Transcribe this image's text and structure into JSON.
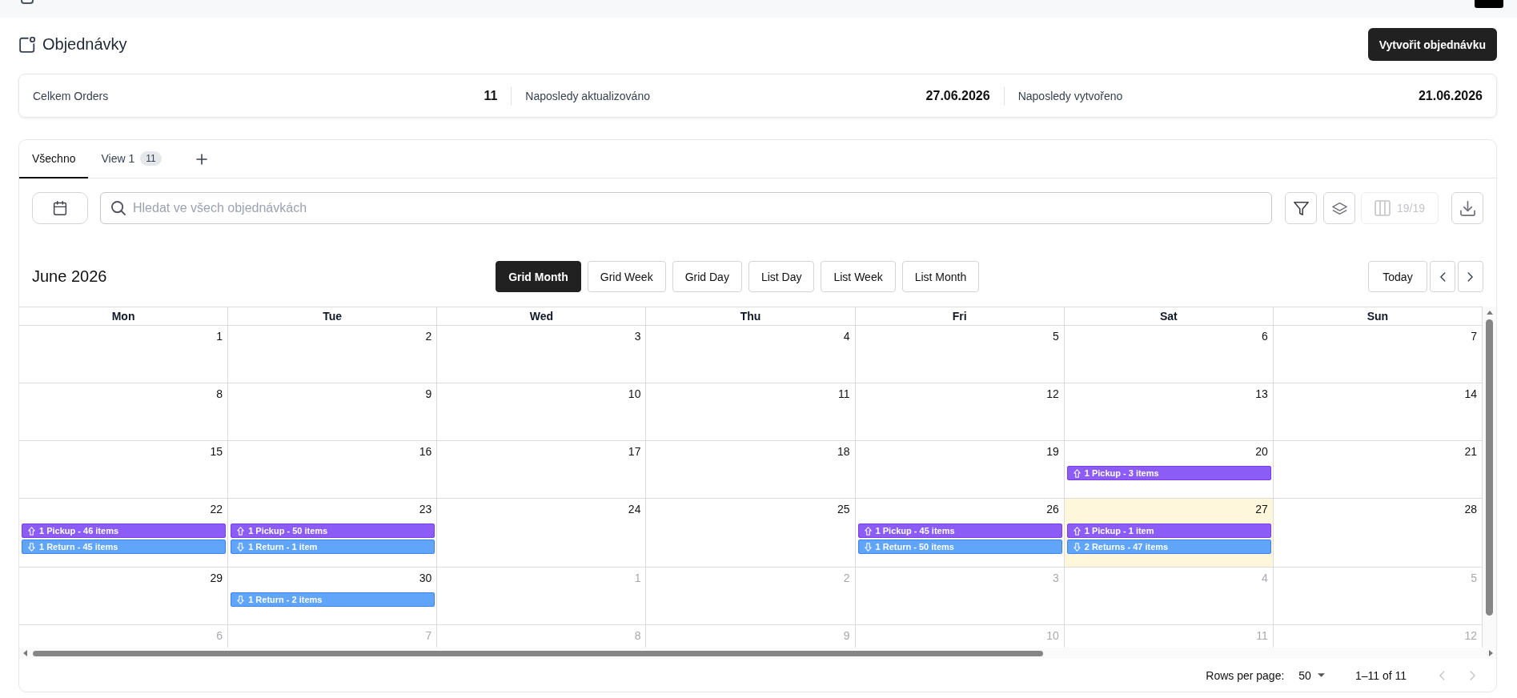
{
  "page": {
    "title": "Objednávky",
    "create_button": "Vytvořit objednávku"
  },
  "stats": [
    {
      "label": "Celkem Orders",
      "value": "11"
    },
    {
      "label": "Naposledy aktualizováno",
      "value": "27.06.2026"
    },
    {
      "label": "Naposledy vytvořeno",
      "value": "21.06.2026"
    }
  ],
  "tabs": [
    {
      "label": "Všechno",
      "selected": true
    },
    {
      "label": "View 1",
      "count": "11",
      "selected": false
    }
  ],
  "toolbar": {
    "search": {
      "placeholder": "Hledat ve všech objednávkách"
    },
    "columns_button": {
      "label": "19/19",
      "disabled": true
    }
  },
  "calendar": {
    "title": "June 2026",
    "views": [
      {
        "label": "Grid Month",
        "selected": true
      },
      {
        "label": "Grid Week",
        "selected": false
      },
      {
        "label": "Grid Day",
        "selected": false
      },
      {
        "label": "List Day",
        "selected": false
      },
      {
        "label": "List Week",
        "selected": false
      },
      {
        "label": "List Month",
        "selected": false
      }
    ],
    "today_button": "Today",
    "weekdays": [
      "Mon",
      "Tue",
      "Wed",
      "Thu",
      "Fri",
      "Sat",
      "Sun"
    ],
    "weeks": [
      {
        "days": [
          {
            "day": "1",
            "outside": false,
            "today": false
          },
          {
            "day": "2",
            "outside": false,
            "today": false
          },
          {
            "day": "3",
            "outside": false,
            "today": false
          },
          {
            "day": "4",
            "outside": false,
            "today": false
          },
          {
            "day": "5",
            "outside": false,
            "today": false
          },
          {
            "day": "6",
            "outside": false,
            "today": false
          },
          {
            "day": "7",
            "outside": false,
            "today": false
          }
        ]
      },
      {
        "days": [
          {
            "day": "8",
            "outside": false,
            "today": false
          },
          {
            "day": "9",
            "outside": false,
            "today": false
          },
          {
            "day": "10",
            "outside": false,
            "today": false
          },
          {
            "day": "11",
            "outside": false,
            "today": false
          },
          {
            "day": "12",
            "outside": false,
            "today": false
          },
          {
            "day": "13",
            "outside": false,
            "today": false
          },
          {
            "day": "14",
            "outside": false,
            "today": false
          }
        ]
      },
      {
        "days": [
          {
            "day": "15",
            "outside": false,
            "today": false
          },
          {
            "day": "16",
            "outside": false,
            "today": false
          },
          {
            "day": "17",
            "outside": false,
            "today": false
          },
          {
            "day": "18",
            "outside": false,
            "today": false
          },
          {
            "day": "19",
            "outside": false,
            "today": false
          },
          {
            "day": "20",
            "outside": false,
            "today": false,
            "events": [
              {
                "kind": "pickup",
                "label": "1 Pickup - 3 items",
                "color": "#8b5cf6"
              }
            ]
          },
          {
            "day": "21",
            "outside": false,
            "today": false
          }
        ]
      },
      {
        "days": [
          {
            "day": "22",
            "outside": false,
            "today": false,
            "events": [
              {
                "kind": "pickup",
                "label": "1 Pickup - 46 items",
                "color": "#8b5cf6"
              },
              {
                "kind": "return",
                "label": "1 Return - 45 items",
                "color": "#60a5fa"
              }
            ]
          },
          {
            "day": "23",
            "outside": false,
            "today": false,
            "events": [
              {
                "kind": "pickup",
                "label": "1 Pickup - 50 items",
                "color": "#8b5cf6"
              },
              {
                "kind": "return",
                "label": "1 Return - 1 item",
                "color": "#60a5fa"
              }
            ]
          },
          {
            "day": "24",
            "outside": false,
            "today": false
          },
          {
            "day": "25",
            "outside": false,
            "today": false
          },
          {
            "day": "26",
            "outside": false,
            "today": false,
            "events": [
              {
                "kind": "pickup",
                "label": "1 Pickup - 45 items",
                "color": "#8b5cf6"
              },
              {
                "kind": "return",
                "label": "1 Return - 50 items",
                "color": "#60a5fa"
              }
            ]
          },
          {
            "day": "27",
            "outside": false,
            "today": true,
            "events": [
              {
                "kind": "pickup",
                "label": "1 Pickup - 1 item",
                "color": "#8b5cf6"
              },
              {
                "kind": "return",
                "label": "2 Returns - 47 items",
                "color": "#60a5fa"
              }
            ]
          },
          {
            "day": "28",
            "outside": false,
            "today": false
          }
        ]
      },
      {
        "days": [
          {
            "day": "29",
            "outside": false,
            "today": false
          },
          {
            "day": "30",
            "outside": false,
            "today": false,
            "events": [
              {
                "kind": "return",
                "label": "1 Return - 2 items",
                "color": "#60a5fa"
              }
            ]
          },
          {
            "day": "1",
            "outside": true,
            "today": false
          },
          {
            "day": "2",
            "outside": true,
            "today": false
          },
          {
            "day": "3",
            "outside": true,
            "today": false
          },
          {
            "day": "4",
            "outside": true,
            "today": false
          },
          {
            "day": "5",
            "outside": true,
            "today": false
          }
        ]
      },
      {
        "days": [
          {
            "day": "6",
            "outside": true,
            "today": false
          },
          {
            "day": "7",
            "outside": true,
            "today": false
          },
          {
            "day": "8",
            "outside": true,
            "today": false
          },
          {
            "day": "9",
            "outside": true,
            "today": false
          },
          {
            "day": "10",
            "outside": true,
            "today": false
          },
          {
            "day": "11",
            "outside": true,
            "today": false
          },
          {
            "day": "12",
            "outside": true,
            "today": false
          }
        ]
      }
    ]
  },
  "pagination": {
    "rows_per_page_label": "Rows per page:",
    "rows_per_page": "50",
    "range": "1–11 of 11",
    "previous_disabled": true,
    "next_disabled": true
  }
}
